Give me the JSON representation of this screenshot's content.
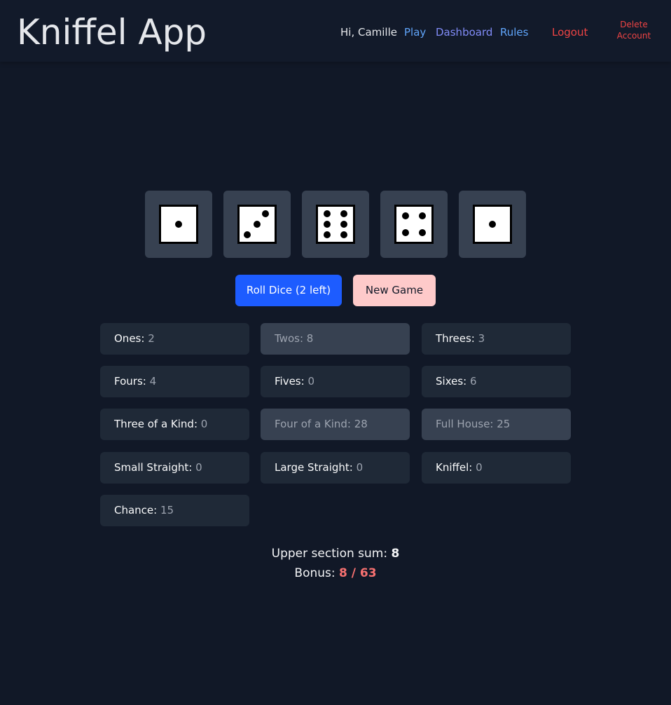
{
  "header": {
    "title": "Kniffel App",
    "greeting": "Hi, Camille",
    "nav": {
      "play": "Play",
      "dashboard": "Dashboard",
      "rules": "Rules",
      "logout": "Logout",
      "delete_line1": "Delete",
      "delete_line2": "Account"
    }
  },
  "dice": [
    1,
    3,
    6,
    4,
    1
  ],
  "buttons": {
    "roll": "Roll Dice (2 left)",
    "new_game": "New Game"
  },
  "scorecard": [
    {
      "label": "Ones:",
      "value": "2",
      "used": false
    },
    {
      "label": "Twos:",
      "value": "8",
      "used": true
    },
    {
      "label": "Threes:",
      "value": "3",
      "used": false
    },
    {
      "label": "Fours:",
      "value": "4",
      "used": false
    },
    {
      "label": "Fives:",
      "value": "0",
      "used": false
    },
    {
      "label": "Sixes:",
      "value": "6",
      "used": false
    },
    {
      "label": "Three of a Kind:",
      "value": "0",
      "used": false
    },
    {
      "label": "Four of a Kind:",
      "value": "28",
      "used": true
    },
    {
      "label": "Full House:",
      "value": "25",
      "used": true
    },
    {
      "label": "Small Straight:",
      "value": "0",
      "used": false
    },
    {
      "label": "Large Straight:",
      "value": "0",
      "used": false
    },
    {
      "label": "Kniffel:",
      "value": "0",
      "used": false
    },
    {
      "label": "Chance:",
      "value": "15",
      "used": false
    }
  ],
  "summary": {
    "upper_label": "Upper section sum:",
    "upper_value": "8",
    "bonus_label": "Bonus:",
    "bonus_value": "8 / 63"
  },
  "colors": {
    "background": "#111827",
    "roll_button": "#1d5cff",
    "new_game_button": "#fecaca",
    "bonus": "#f87171",
    "logout": "#ef4444"
  }
}
